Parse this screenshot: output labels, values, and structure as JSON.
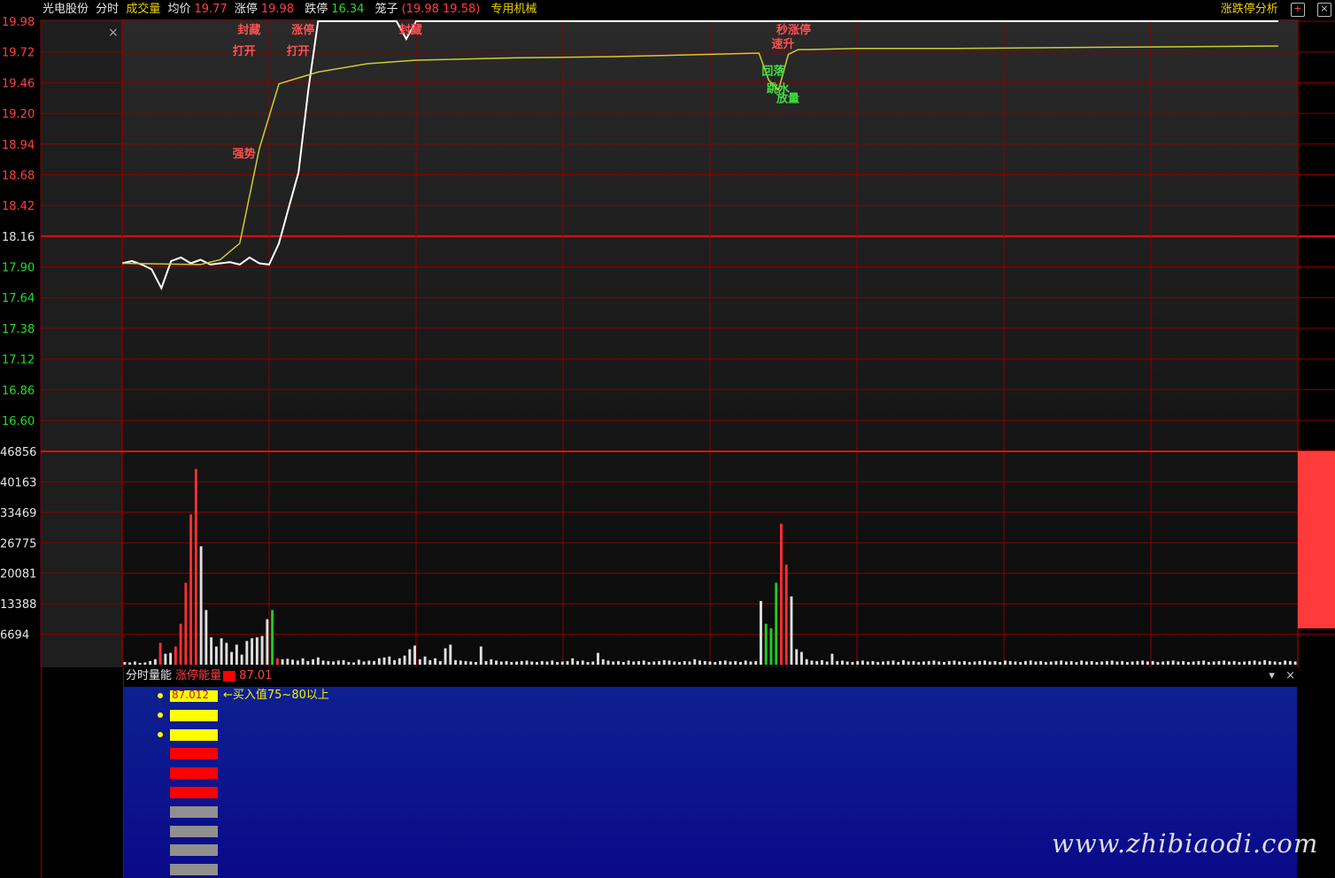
{
  "header": {
    "stock_name": "光电股份",
    "tab_intraday": "分时",
    "tab_volume": "成交量",
    "avg_label": "均价",
    "avg_value": "19.77",
    "limit_up_label": "涨停",
    "limit_up_value": "19.98",
    "limit_down_label": "跌停",
    "limit_down_value": "16.34",
    "cage_label": "笼子",
    "cage_value": "(19.98 19.58)",
    "sector": "专用机械",
    "analysis": "涨跌停分析"
  },
  "colors": {
    "grid": "#8b0000",
    "price_line": "#ffffff",
    "avg_line": "#cccc33",
    "up": "#ff3030",
    "down": "#22cc22",
    "flat": "#e0e0e0",
    "panel_bg": "#0a1a8c"
  },
  "chart_data": [
    {
      "type": "line",
      "y_ticks": [
        "19.98",
        "19.72",
        "19.46",
        "19.20",
        "18.94",
        "18.68",
        "18.42",
        "18.16",
        "17.90",
        "17.64",
        "17.38",
        "17.12",
        "16.86",
        "16.60"
      ],
      "ylim": [
        16.6,
        19.98
      ],
      "prev_close": 18.16,
      "x_sessions": 240,
      "series": [
        {
          "x": [
            0,
            2,
            4,
            6,
            8,
            10,
            12,
            14,
            16,
            18,
            20,
            22,
            24,
            26,
            28,
            30,
            32,
            34,
            36,
            38,
            40,
            42,
            44,
            46,
            48,
            50,
            52,
            54,
            56,
            58,
            60,
            62,
            64,
            66,
            68,
            70,
            72,
            74,
            76,
            78,
            80,
            82,
            84,
            86,
            88,
            90,
            92,
            94,
            96,
            98,
            100,
            104,
            108,
            112,
            116,
            120,
            130,
            140,
            150,
            160,
            170,
            180,
            190,
            200,
            210,
            220,
            230,
            236
          ],
          "y": [
            17.93,
            17.95,
            17.92,
            17.88,
            17.72,
            17.95,
            17.98,
            17.93,
            17.96,
            17.92,
            17.93,
            17.94,
            17.92,
            17.98,
            17.93,
            17.92,
            18.1,
            18.4,
            18.7,
            19.4,
            19.98,
            19.98,
            19.98,
            19.98,
            19.98,
            19.98,
            19.98,
            19.98,
            19.98,
            19.83,
            19.98,
            19.98,
            19.98,
            19.98,
            19.98,
            19.98,
            19.98,
            19.98,
            19.98,
            19.98,
            19.98,
            19.98,
            19.98,
            19.98,
            19.98,
            19.98,
            19.98,
            19.98,
            19.98,
            19.98,
            19.98,
            19.98,
            19.98,
            19.98,
            19.98,
            19.98,
            19.98,
            19.98,
            19.98,
            19.98,
            19.98,
            19.98,
            19.98,
            19.98,
            19.98,
            19.98,
            19.98,
            19.98
          ]
        },
        {
          "x": [
            0,
            16,
            20,
            24,
            28,
            32,
            36,
            40,
            50,
            60,
            80,
            100,
            120,
            130,
            132,
            134,
            136,
            138,
            140,
            150,
            170,
            200,
            236
          ],
          "y": [
            17.93,
            17.92,
            17.96,
            18.1,
            18.9,
            19.45,
            19.5,
            19.55,
            19.62,
            19.65,
            19.67,
            19.68,
            19.7,
            19.71,
            19.48,
            19.4,
            19.7,
            19.74,
            19.74,
            19.75,
            19.75,
            19.76,
            19.77
          ]
        }
      ],
      "annotations": [
        {
          "text": "封藏",
          "x": 25,
          "y": 19.98
        },
        {
          "text": "打开",
          "x": 24,
          "y": 19.8
        },
        {
          "text": "强势",
          "x": 24,
          "y": 18.93
        },
        {
          "text": "涨停",
          "x": 36,
          "y": 19.98
        },
        {
          "text": "打开",
          "x": 35,
          "y": 19.8
        },
        {
          "text": "封藏",
          "x": 58,
          "y": 19.98
        },
        {
          "text": "秒涨停",
          "x": 135,
          "y": 19.98
        },
        {
          "text": "速升",
          "x": 134,
          "y": 19.86
        },
        {
          "text": "回落",
          "x": 132,
          "y": 19.63
        },
        {
          "text": "跳水",
          "x": 133,
          "y": 19.48
        },
        {
          "text": "放量",
          "x": 135,
          "y": 19.4
        }
      ]
    },
    {
      "type": "bar",
      "y_ticks": [
        "46856",
        "40163",
        "33469",
        "26775",
        "20081",
        "13388",
        "6694"
      ],
      "ylim": [
        0,
        46856
      ],
      "values": [
        600,
        500,
        700,
        400,
        500,
        800,
        1200,
        4800,
        2400,
        2600,
        4000,
        9000,
        18000,
        33000,
        43000,
        26000,
        12000,
        6000,
        4000,
        5800,
        4800,
        2800,
        4400,
        2200,
        5200,
        5800,
        6000,
        6300,
        10000,
        12000,
        1400,
        1200,
        1300,
        1100,
        900,
        1400,
        800,
        1200,
        1600,
        900,
        800,
        700,
        900,
        1000,
        600,
        500,
        1100,
        700,
        900,
        800,
        1400,
        1600,
        1800,
        1000,
        1400,
        2000,
        3400,
        4200,
        1200,
        1800,
        1000,
        1400,
        800,
        3600,
        4400,
        1000,
        900,
        800,
        700,
        600,
        4000,
        800,
        1200,
        900,
        700,
        800,
        600,
        700,
        800,
        900,
        700,
        600,
        800,
        700,
        900,
        600,
        700,
        800,
        1400,
        800,
        900,
        600,
        700,
        2600,
        1200,
        900,
        700,
        800,
        600,
        900,
        700,
        800,
        900,
        600,
        700,
        800,
        1000,
        900,
        700,
        600,
        800,
        700,
        1200,
        900,
        800,
        700,
        600,
        800,
        900,
        700,
        800,
        600,
        900,
        700,
        800,
        14000,
        9000,
        8000,
        18000,
        31000,
        22000,
        15000,
        3400,
        2800,
        1200,
        900,
        800,
        1000,
        700,
        2400,
        800,
        900,
        700,
        600,
        800,
        900,
        700,
        800,
        600,
        700,
        800,
        900,
        600,
        1000,
        700,
        800,
        600,
        700,
        800,
        900,
        700,
        600,
        800,
        900,
        700,
        800,
        600,
        700,
        800,
        900,
        700,
        800,
        600,
        900,
        800,
        700,
        600,
        800,
        900,
        700,
        800,
        600,
        700,
        800,
        900,
        700,
        800,
        600,
        900,
        700,
        800,
        600,
        700,
        800,
        900,
        700,
        800,
        600,
        700,
        800,
        900,
        700,
        800,
        600,
        700,
        800,
        900,
        700,
        800,
        600,
        700,
        800,
        900,
        600,
        700,
        800,
        900,
        700,
        800,
        600,
        700,
        800,
        900,
        700,
        1000,
        800,
        700,
        600,
        900,
        800,
        700
      ],
      "colors": "up/down/flat per bar"
    }
  ],
  "panel": {
    "title": "分时量能",
    "indicator_label": "涨停能量",
    "indicator_value": "87.01",
    "bar_value": "87.012",
    "hint": "←买入值75~80以上",
    "bars": [
      {
        "color": "#ffff00",
        "dot": true
      },
      {
        "color": "#ffff00",
        "dot": true
      },
      {
        "color": "#ffff00",
        "dot": true
      },
      {
        "color": "#ff0000",
        "dot": false
      },
      {
        "color": "#ff0000",
        "dot": false
      },
      {
        "color": "#ff0000",
        "dot": false
      },
      {
        "color": "#909090",
        "dot": false
      },
      {
        "color": "#909090",
        "dot": false
      },
      {
        "color": "#909090",
        "dot": false
      },
      {
        "color": "#909090",
        "dot": false
      }
    ]
  },
  "watermark": "www.zhibiaodi.com"
}
